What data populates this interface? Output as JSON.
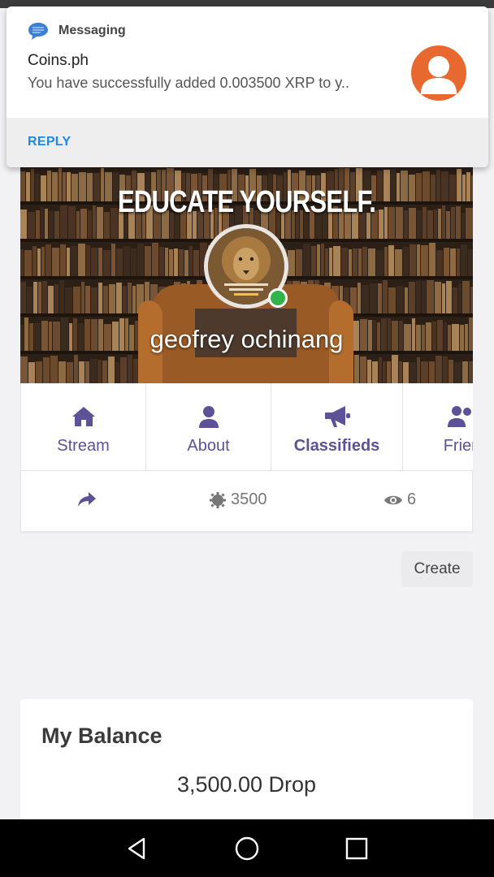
{
  "notification": {
    "app_name": "Messaging",
    "title": "Coins.ph",
    "text": "You have successfully added 0.003500 XRP to y..",
    "reply_label": "REPLY"
  },
  "profile": {
    "cover_caption": "EDUCATE YOURSELF.",
    "name": "geofrey ochinang",
    "online": true
  },
  "tabs": [
    {
      "label": "Stream",
      "icon": "home-icon"
    },
    {
      "label": "About",
      "icon": "user-icon"
    },
    {
      "label": "Classifieds",
      "icon": "megaphone-icon",
      "active": true
    },
    {
      "label": "Frien",
      "icon": "friends-icon"
    }
  ],
  "stats": {
    "share_icon": "share-icon",
    "points": "3500",
    "views": "6"
  },
  "create_label": "Create",
  "balance": {
    "title": "My Balance",
    "value": "3,500.00 Drop"
  },
  "colors": {
    "accent": "#5c5297",
    "online": "#2fb34a",
    "reply": "#1e88e5"
  }
}
